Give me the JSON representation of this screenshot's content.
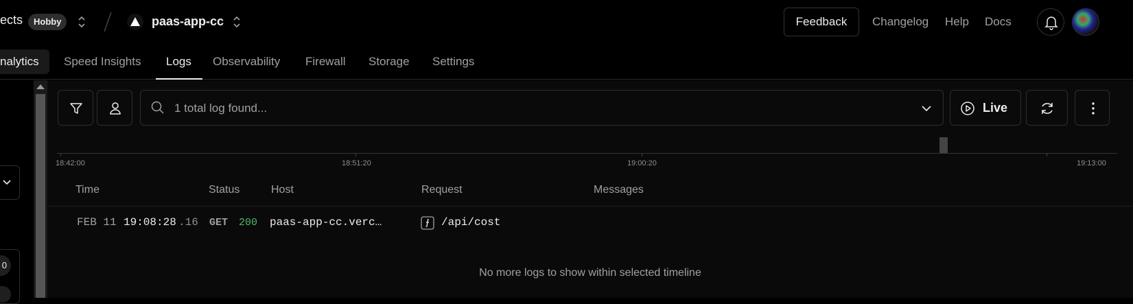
{
  "topbar": {
    "projects_label": "ects",
    "plan_badge": "Hobby",
    "project_name": "paas-app-cc",
    "feedback_label": "Feedback",
    "links": [
      "Changelog",
      "Help",
      "Docs"
    ]
  },
  "tabs": {
    "items": [
      "nalytics",
      "Speed Insights",
      "Logs",
      "Observability",
      "Firewall",
      "Storage",
      "Settings"
    ],
    "active": "Logs"
  },
  "left_panel": {
    "pill_text": "0"
  },
  "toolbar": {
    "search_text": "1 total log found...",
    "live_label": "Live"
  },
  "timeline": {
    "ticks": [
      "18:42:00",
      "18:51:20",
      "19:00:20",
      "19:13:00"
    ]
  },
  "table": {
    "columns": [
      "Time",
      "Status",
      "Host",
      "Request",
      "Messages"
    ],
    "rows": [
      {
        "date": "FEB 11",
        "time": "19:08:28",
        "ms": ".16",
        "method": "GET",
        "status": "200",
        "host": "paas-app-cc.verc…",
        "request": "/api/cost",
        "message": ""
      }
    ],
    "empty_message": "No more logs to show within selected timeline"
  },
  "colors": {
    "status_ok": "#4fb86b",
    "background": "#000000",
    "panel": "#0a0a0a",
    "border": "#2e2e2e"
  },
  "icons": [
    "chevron-updown-icon",
    "vercel-triangle-icon",
    "bell-icon",
    "filter-icon",
    "user-icon",
    "search-icon",
    "chevron-down-icon",
    "play-circle-icon",
    "refresh-icon",
    "more-vertical-icon",
    "function-icon"
  ]
}
